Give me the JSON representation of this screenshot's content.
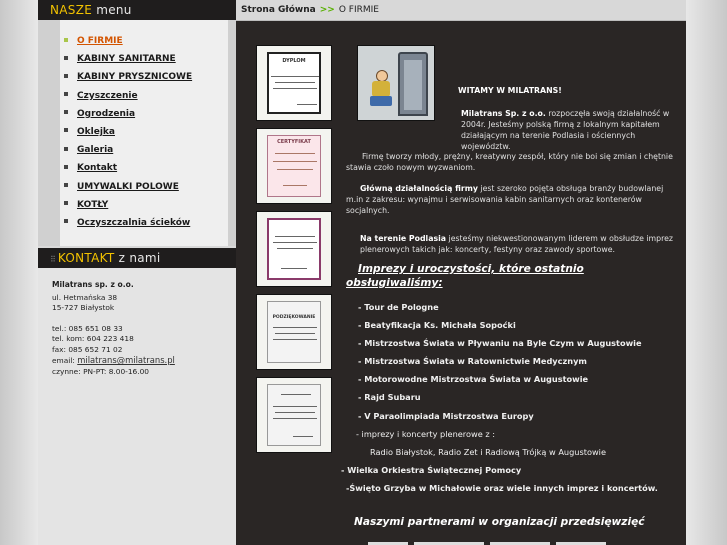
{
  "sidebar": {
    "menu_header": {
      "accent": "NASZE",
      "rest": "menu"
    },
    "menu_items": [
      {
        "label": "O FIRMIE",
        "active": true
      },
      {
        "label": "KABINY SANITARNE"
      },
      {
        "label": "KABINY PRYSZNICOWE"
      },
      {
        "label": "Czyszczenie"
      },
      {
        "label": "Ogrodzenia"
      },
      {
        "label": "Oklejka"
      },
      {
        "label": "Galeria"
      },
      {
        "label": "Kontakt"
      },
      {
        "label": "UMYWALKI POLOWE"
      },
      {
        "label": "KOTŁY"
      },
      {
        "label": "Oczyszczalnia ścieków"
      }
    ],
    "contact_header": {
      "accent": "KONTAKT",
      "rest": "z nami"
    },
    "contact": {
      "company": "Milatrans sp. z o.o.",
      "street": "ul. Hetmańska 38",
      "city": "15-727 Białystok",
      "tel": "tel.: 085 651 08 33",
      "mobile": "tel. kom: 604 223 418",
      "fax": "fax: 085 652 71 02",
      "email_label": "email:",
      "email": "milatrans@milatrans.pl",
      "hours": "czynne: PN-PT: 8.00-16.00"
    }
  },
  "breadcrumb": {
    "home": "Strona Główna",
    "sep": ">>",
    "current": "O FIRMIE"
  },
  "thumbs": [
    {
      "title": "DYPLOM"
    },
    {
      "title": "CERTYFIKAT"
    },
    {
      "title": ""
    },
    {
      "title": "PODZIĘKOWANIE"
    },
    {
      "title": ""
    }
  ],
  "content": {
    "welcome": "WITAMY W MILATRANS!",
    "intro_lead": "Milatrans Sp. z o.o.",
    "intro_rest": " rozpoczęła swoją działalność w 2004r. Jesteśmy polską firmą z lokalnym kapitałem działającym na terenie Podlasia i ościennych województw.",
    "team": "Firmę tworzy młody, prężny, kreatywny zespół, który nie boi się zmian i chętnie stawia czoło nowym wyzwaniom.",
    "main_lead": "Główną działalnością firmy",
    "main_rest": " jest szeroko pojęta obsługa branży budowlanej",
    "main_line2": "m.in z zakresu: wynajmu i serwisowania kabin sanitarnych oraz kontenerów socjalnych.",
    "podlasie_lead": "Na terenie Podlasia",
    "podlasie_rest": " jesteśmy niekwestionowanym liderem  w obsłudze imprez plenerowych takich jak: koncerty, festyny oraz zawody sportowe.",
    "events_title": "Imprezy i uroczystości, które ostatnio obsługiwaliśmy:",
    "events": [
      "-  Tour de Pologne",
      "-  Beatyfikacja Ks. Michała Sopoćki",
      "-  Mistrzostwa Świata w Pływaniu na Byle Czym w Augustowie",
      "-  Mistrzostwa Świata w Ratownictwie Medycznym",
      "-  Motorowodne Mistrzostwa Świata w Augustowie",
      "-  Rajd Subaru",
      "-  V Paraolimpiada Mistrzostwa Europy",
      "- imprezy i koncerty plenerowe z :",
      "Radio Białystok, Radio Zet  i Radiową Trójką w Augustowie",
      "-  Wielka Orkiestra Świątecznej Pomocy",
      "-Święto Grzyba w Michałowie   oraz wiele innych  imprez i koncertów."
    ],
    "partners": "Naszymi partnerami w organizacji przedsięwzięć"
  }
}
